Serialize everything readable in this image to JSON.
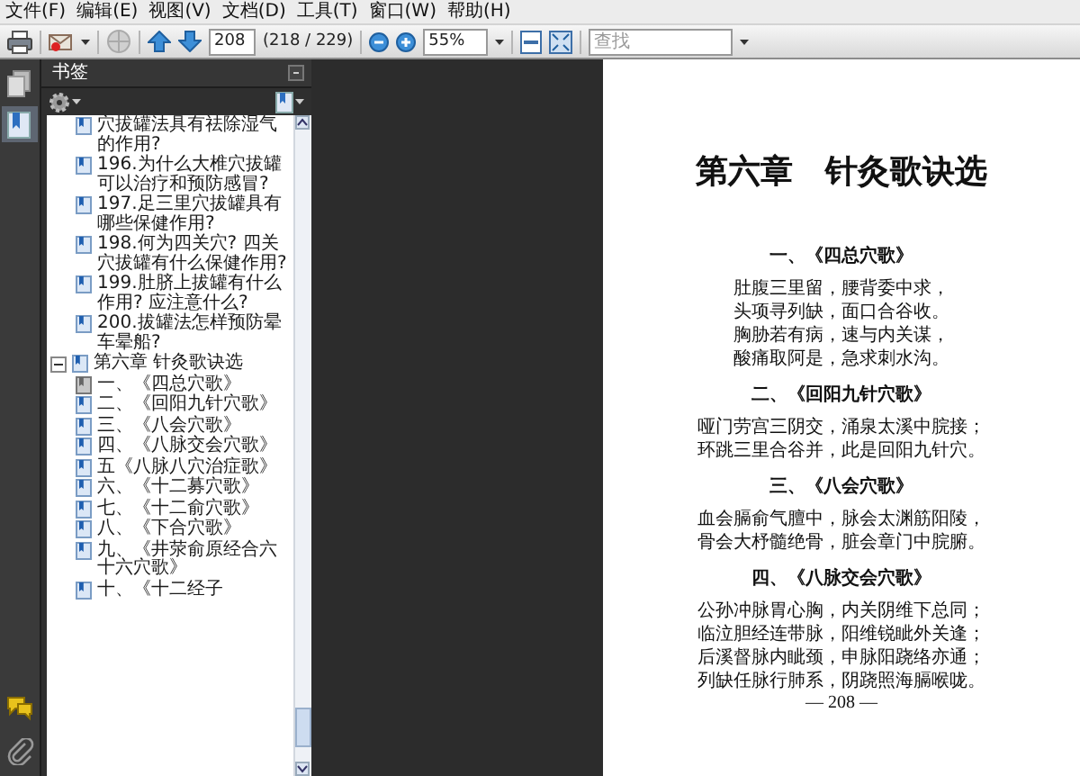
{
  "menu": [
    "文件(F)",
    "编辑(E)",
    "视图(V)",
    "文档(D)",
    "工具(T)",
    "窗口(W)",
    "帮助(H)"
  ],
  "toolbar": {
    "page_number": "208",
    "page_position": "(218 / 229)",
    "zoom": "55%",
    "search": {
      "placeholder": "查找"
    }
  },
  "side_tabs": [
    {
      "kind": "pages",
      "selected": false
    },
    {
      "kind": "bookmarks",
      "selected": true
    }
  ],
  "bottom_tabs": [
    {
      "kind": "comments"
    },
    {
      "kind": "attachments"
    }
  ],
  "bookmarks": {
    "title": "书签",
    "items": [
      {
        "label": "穴拔罐法具有祛除湿气的作用?",
        "selected": false
      },
      {
        "label": "196.为什么大椎穴拔罐可以治疗和预防感冒?",
        "selected": false
      },
      {
        "label": "197.足三里穴拔罐具有哪些保健作用?",
        "selected": false
      },
      {
        "label": "198.何为四关穴? 四关穴拔罐有什么保健作用?",
        "selected": false
      },
      {
        "label": "199.肚脐上拔罐有什么作用? 应注意什么?",
        "selected": false
      },
      {
        "label": "200.拔罐法怎样预防晕车晕船?",
        "selected": false
      },
      {
        "label": "第六章 针灸歌诀选",
        "selected": false,
        "expanded": true,
        "children": [
          {
            "label": "一、《四总穴歌》",
            "selected": true
          },
          {
            "label": "二、《回阳九针穴歌》",
            "selected": false
          },
          {
            "label": "三、《八会穴歌》",
            "selected": false
          },
          {
            "label": "四、《八脉交会穴歌》",
            "selected": false
          },
          {
            "label": "五《八脉八穴治症歌》",
            "selected": false
          },
          {
            "label": "六、《十二募穴歌》",
            "selected": false
          },
          {
            "label": "七、《十二俞穴歌》",
            "selected": false
          },
          {
            "label": "八、《下合穴歌》",
            "selected": false
          },
          {
            "label": "九、《井荥俞原经合六十六穴歌》",
            "selected": false
          },
          {
            "label": "十、《十二经子",
            "selected": false
          }
        ]
      }
    ]
  },
  "document": {
    "title": "第六章　针灸歌诀选",
    "sections": [
      {
        "heading": "一、《四总穴歌》",
        "lines": [
          "肚腹三里留，腰背委中求，",
          "头项寻列缺，面口合谷收。",
          "胸胁若有病，速与内关谋，",
          "酸痛取阿是，急求刺水沟。"
        ]
      },
      {
        "heading": "二、《回阳九针穴歌》",
        "lines": [
          "哑门劳宫三阴交，涌泉太溪中脘接；",
          "环跳三里合谷并，此是回阳九针穴。"
        ]
      },
      {
        "heading": "三、《八会穴歌》",
        "lines": [
          "血会膈俞气膻中，脉会太渊筋阳陵，",
          "骨会大杼髓绝骨，脏会章门中脘腑。"
        ]
      },
      {
        "heading": "四、《八脉交会穴歌》",
        "lines": [
          "公孙冲脉胃心胸，内关阴维下总同；",
          "临泣胆经连带脉，阳维锐眦外关逢；",
          "后溪督脉内眦颈，申脉阳跷络亦通；",
          "列缺任脉行肺系，阴跷照海膈喉咙。"
        ]
      }
    ],
    "footer": "— 208 —"
  }
}
